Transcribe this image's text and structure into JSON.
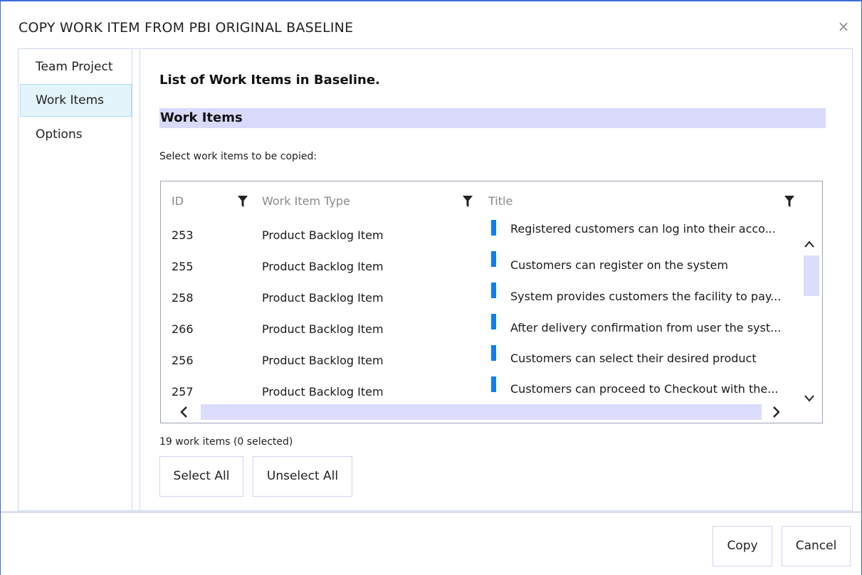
{
  "dialog": {
    "title": "COPY WORK ITEM FROM PBI ORIGINAL BASELINE",
    "close_icon": "×"
  },
  "nav": {
    "items": [
      {
        "label": "Team Project",
        "active": false
      },
      {
        "label": "Work Items",
        "active": true
      },
      {
        "label": "Options",
        "active": false
      }
    ]
  },
  "main": {
    "heading": "List of Work Items in Baseline.",
    "section_title": "Work Items",
    "instruction": "Select work items to be copied:",
    "grid": {
      "columns": [
        "ID",
        "Work Item Type",
        "Title"
      ],
      "rows": [
        {
          "id": "253",
          "type": "Product Backlog Item",
          "title": "Registered customers can log into their acco..."
        },
        {
          "id": "255",
          "type": "Product Backlog Item",
          "title": "Customers can register on the system"
        },
        {
          "id": "258",
          "type": "Product Backlog Item",
          "title": "System provides customers the facility to pay..."
        },
        {
          "id": "266",
          "type": "Product Backlog Item",
          "title": "After delivery confirmation from user the syst..."
        },
        {
          "id": "256",
          "type": "Product Backlog Item",
          "title": "Customers can select their desired product"
        },
        {
          "id": "257",
          "type": "Product Backlog Item",
          "title": "Customers can proceed to Checkout with the..."
        }
      ]
    },
    "count_text": "19 work items (0 selected)",
    "select_all_label": "Select All",
    "unselect_all_label": "Unselect All"
  },
  "footer": {
    "copy_label": "Copy",
    "cancel_label": "Cancel"
  },
  "colors": {
    "accent_border": "#3c6fd8",
    "section_bar": "#d9d9fb",
    "active_nav": "#e3f4fb",
    "row_marker": "#0f7ff0",
    "scroll": "#dcdcfc"
  }
}
